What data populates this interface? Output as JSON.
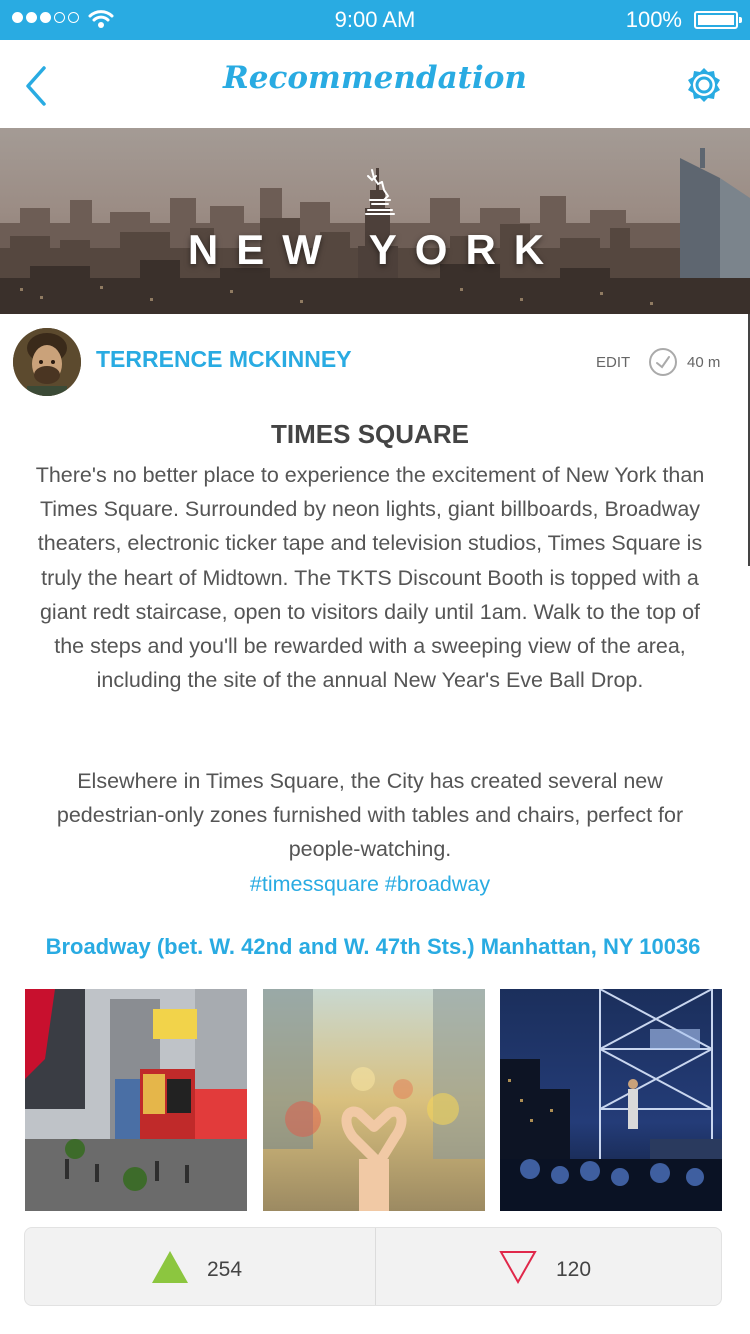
{
  "status_bar": {
    "time": "9:00 AM",
    "battery": "100%",
    "signal_icon": "signal-dots-icon",
    "wifi_icon": "wifi-icon",
    "battery_icon": "battery-icon"
  },
  "nav": {
    "title": "Recommendation",
    "back_icon": "chevron-left-icon",
    "settings_icon": "gear-icon",
    "accent_color": "#29abe2"
  },
  "hero": {
    "title": "NEW YORK",
    "icon": "statue-of-liberty-icon"
  },
  "post": {
    "author": "TERRENCE MCKINNEY",
    "edit_label": "EDIT",
    "duration": "40 m",
    "title": "TIMES SQUARE",
    "body": "There's no better place to experience the excitement of New York than Times Square. Surrounded by neon lights, giant billboards, Broadway theaters, electronic ticker tape and television studios, Times Square is truly the heart of Midtown. The TKTS Discount Booth is topped with a giant redt staircase, open to visitors daily until 1am. Walk to the top of the steps and you'll be rewarded with a sweeping view of the area, including the site of the annual New Year's Eve Ball Drop.",
    "body2": "Elsewhere in Times Square, the City has created several new pedestrian-only zones furnished with tables and chairs, perfect for people-watching.",
    "hashtags": "#timessquare #broadway",
    "address": "Broadway (bet. W. 42nd and W. 47th Sts.) Manhattan, NY 10036"
  },
  "photos": [
    {
      "name": "times-square-billboards"
    },
    {
      "name": "heart-hands-street"
    },
    {
      "name": "concert-stage"
    }
  ],
  "votes": {
    "up_count": "254",
    "down_count": "120",
    "up_color": "#8cc63f",
    "down_color": "#e0284a"
  }
}
